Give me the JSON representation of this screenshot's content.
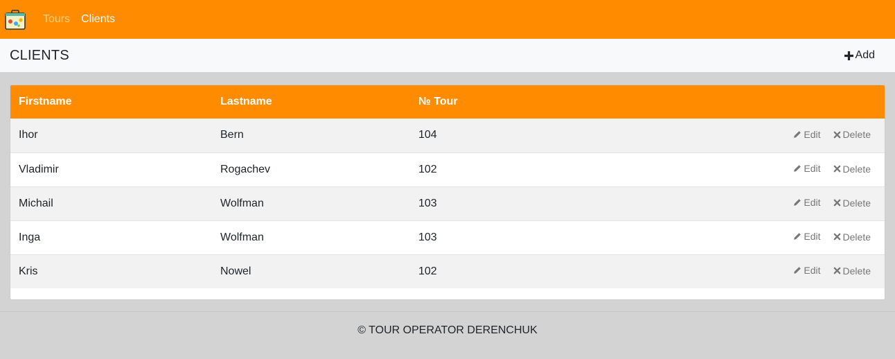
{
  "nav": {
    "links": [
      "Tours",
      "Clients"
    ]
  },
  "page": {
    "title": "CLIENTS",
    "add_label": "Add"
  },
  "table": {
    "headers": [
      "Firstname",
      "Lastname",
      "№ Tour"
    ],
    "edit_label": "Edit",
    "delete_label": "Delete",
    "rows": [
      [
        "Ihor",
        "Bern",
        "104"
      ],
      [
        "Vladimir",
        "Rogachev",
        "102"
      ],
      [
        "Michail",
        "Wolfman",
        "103"
      ],
      [
        "Inga",
        "Wolfman",
        "103"
      ],
      [
        "Kris",
        "Nowel",
        "102"
      ]
    ]
  },
  "footer": {
    "text": "© TOUR OPERATOR DERENCHUK"
  },
  "colors": {
    "accent": "#ff8c00",
    "background": "#d3d3d3"
  },
  "icons": [
    "suitcase-logo-icon",
    "plus-icon",
    "pencil-icon",
    "times-icon"
  ]
}
